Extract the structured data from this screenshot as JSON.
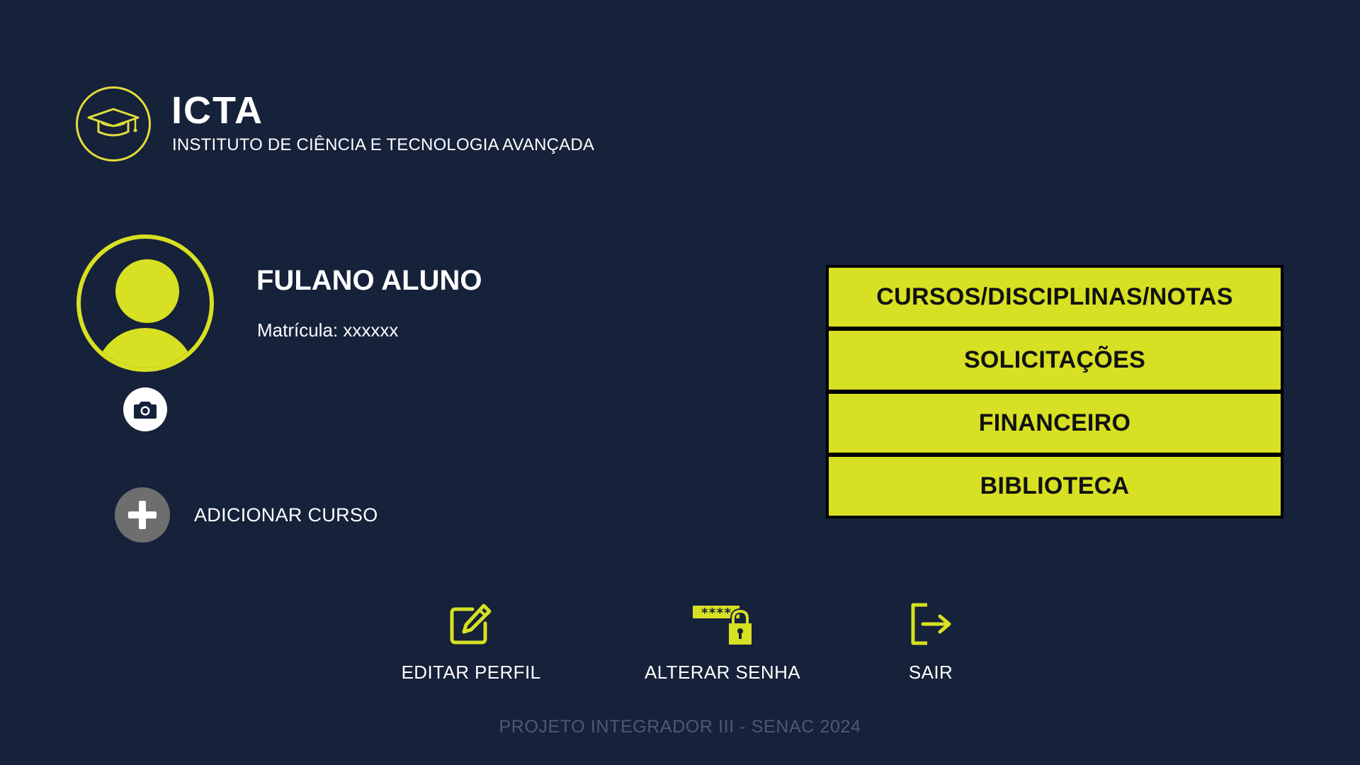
{
  "brand": {
    "title": "ICTA",
    "subtitle": "INSTITUTO DE CIÊNCIA E TECNOLOGIA AVANÇADA",
    "logo_icon": "graduation-cap-icon"
  },
  "profile": {
    "name": "FULANO ALUNO",
    "enrollment": "Matrícula: xxxxxx",
    "avatar_icon": "user-avatar-icon",
    "camera_icon": "camera-icon"
  },
  "add_course": {
    "label": "ADICIONAR CURSO",
    "icon": "plus-icon"
  },
  "menu": {
    "items": [
      {
        "label": "CURSOS/DISCIPLINAS/NOTAS"
      },
      {
        "label": "SOLICITAÇÕES"
      },
      {
        "label": "FINANCEIRO"
      },
      {
        "label": "BIBLIOTECA"
      }
    ]
  },
  "actions": {
    "edit_profile": {
      "label": "EDITAR PERFIL",
      "icon": "edit-icon"
    },
    "change_password": {
      "label": "ALTERAR SENHA",
      "icon": "password-lock-icon"
    },
    "logout": {
      "label": "SAIR",
      "icon": "logout-icon"
    }
  },
  "footer": {
    "text": "PROJETO INTEGRADOR III - SENAC 2024"
  },
  "colors": {
    "background": "#16213a",
    "accent": "#d7e022",
    "logo_accent": "#e2dd3e",
    "footer_text": "#4e5873"
  }
}
